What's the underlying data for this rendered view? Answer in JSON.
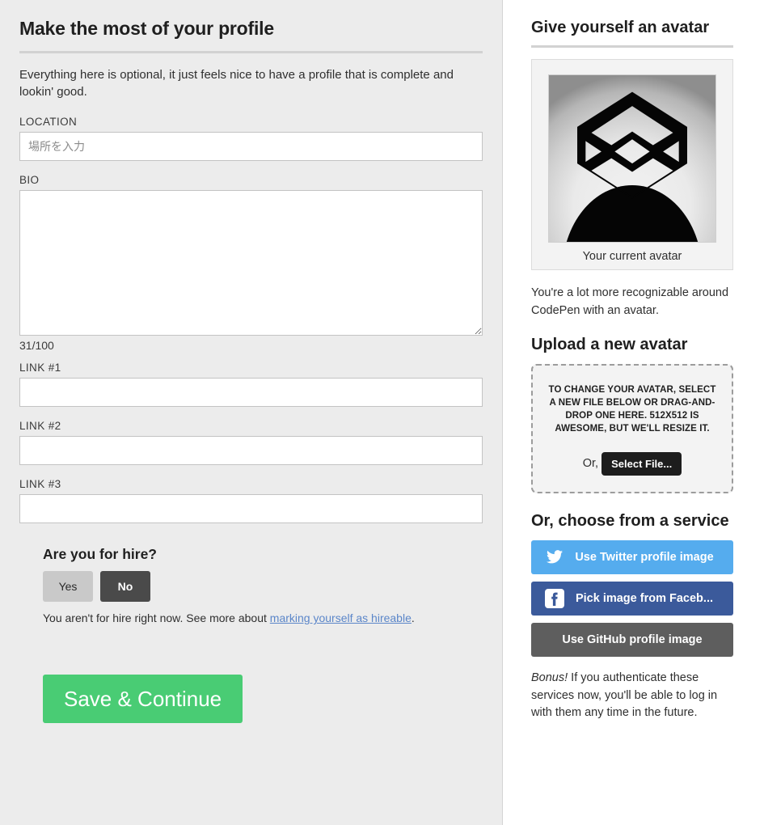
{
  "left": {
    "title": "Make the most of your profile",
    "intro": "Everything here is optional, it just feels nice to have a profile that is complete and lookin' good.",
    "fields": {
      "location_label": "LOCATION",
      "location_value": "",
      "location_placeholder": "場所を入力",
      "bio_label": "BIO",
      "bio_value": "",
      "bio_counter": "31/100",
      "link1_label": "LINK #1",
      "link1_value": "",
      "link2_label": "LINK #2",
      "link2_value": "",
      "link3_label": "LINK #3",
      "link3_value": ""
    },
    "hire": {
      "title": "Are you for hire?",
      "yes_label": "Yes",
      "no_label": "No",
      "selected": "No",
      "note_before": "You aren't for hire right now. See more about ",
      "note_link": "marking yourself as hireable",
      "note_after": "."
    },
    "save_label": "Save & Continue"
  },
  "right": {
    "avatar_section_title": "Give yourself an avatar",
    "avatar_caption": "Your current avatar",
    "recognizable_text": "You're a lot more recognizable around CodePen with an avatar.",
    "upload_title": "Upload a new avatar",
    "dropzone_text": "TO CHANGE YOUR AVATAR, SELECT A NEW FILE BELOW OR DRAG-AND-DROP ONE HERE. 512X512 IS AWESOME, BUT WE'LL RESIZE IT.",
    "or_label": "Or,",
    "select_file_label": "Select File...",
    "services_title": "Or, choose from a service",
    "services": [
      {
        "id": "twitter",
        "label": "Use Twitter profile image",
        "icon": "twitter-icon",
        "color": "#55acee"
      },
      {
        "id": "facebook",
        "label": "Pick image from Faceb...",
        "icon": "facebook-icon",
        "color": "#3b5a9b"
      },
      {
        "id": "github",
        "label": "Use GitHub profile image",
        "icon": "",
        "color": "#5e5e5e"
      }
    ],
    "bonus_prefix": "Bonus!",
    "bonus_text": " If you authenticate these services now, you'll be able to log in with them any time in the future."
  },
  "colors": {
    "panel_bg": "#ececec",
    "save_green": "#49cc74",
    "link_blue": "#5b86c9",
    "twitter_blue": "#55acee",
    "facebook_blue": "#3b5a9b",
    "github_gray": "#5e5e5e",
    "toggle_on": "#4a4a4a",
    "toggle_off": "#c9c9c9"
  }
}
